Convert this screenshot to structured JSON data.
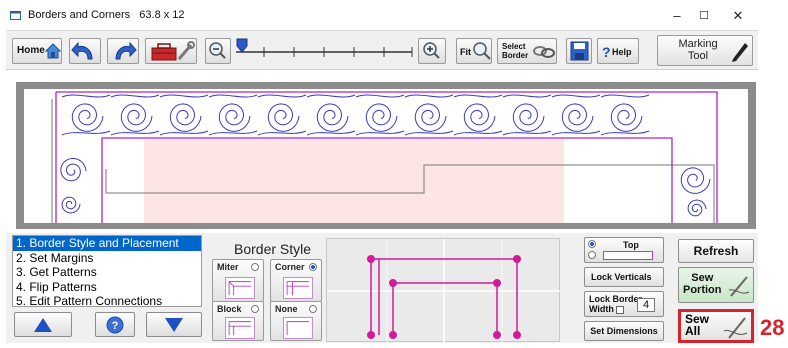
{
  "window": {
    "title": "Borders and Corners",
    "size_label": "63.8 x 12",
    "controls": [
      "–",
      "☐",
      "✕"
    ]
  },
  "toolbar": {
    "home_label": "Home",
    "fit_label": "Fit",
    "select_border_label_1": "Select",
    "select_border_label_2": "Border",
    "help_label": "Help",
    "marking_tool_label_1": "Marking",
    "marking_tool_label_2": "Tool"
  },
  "steps": [
    "1. Border Style and Placement",
    "2. Set Margins",
    "3. Get Patterns",
    "4. Flip Patterns",
    "5. Edit Pattern Connections"
  ],
  "selected_step": 0,
  "border_style": {
    "title": "Border Style",
    "miter": "Miter",
    "corner": "Corner",
    "block": "Block",
    "none": "None",
    "selected": "corner"
  },
  "options": {
    "top_label": "Top",
    "lock_verticals": "Lock Verticals",
    "lock_border_width_1": "Lock Border",
    "lock_border_width_2": "Width",
    "border_width_value": "4",
    "set_dimensions": "Set Dimensions"
  },
  "actions": {
    "refresh": "Refresh",
    "sew_portion_1": "Sew",
    "sew_portion_2": "Portion",
    "sew_all_1": "Sew",
    "sew_all_2": "All"
  },
  "badge": "28",
  "colors": {
    "border_pattern": "#3a3ac0",
    "border_outline": "#b020c8",
    "selection": "#0066cc",
    "highlight": "#d9232b"
  }
}
